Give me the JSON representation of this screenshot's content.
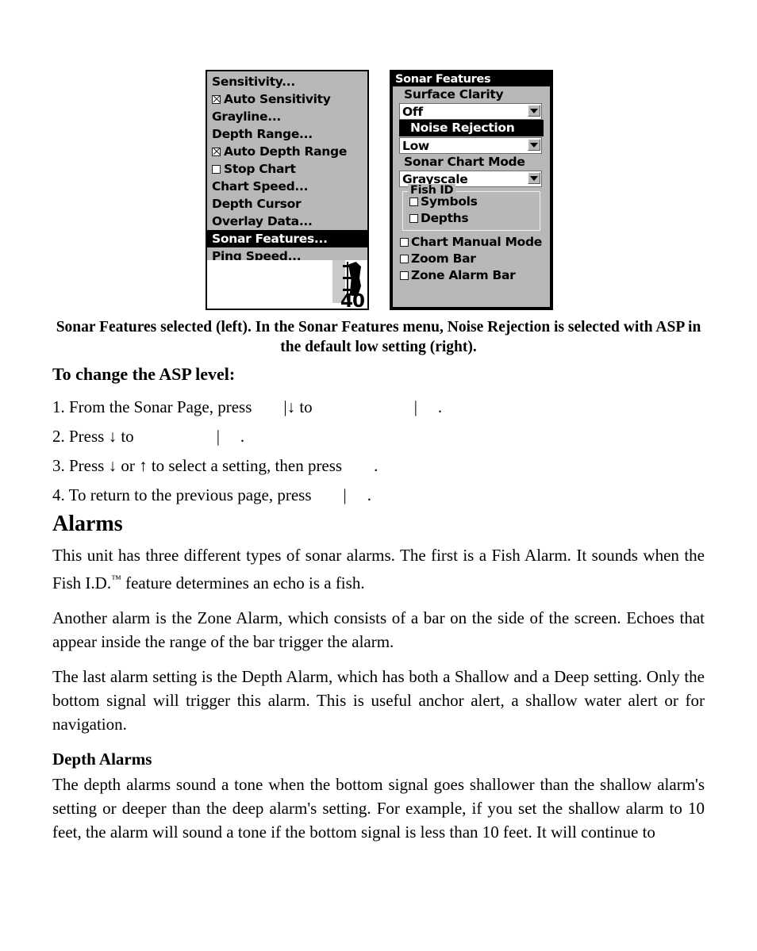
{
  "figure": {
    "left_panel": {
      "name": "sonar-main-menu",
      "items": [
        {
          "label": "Sensitivity...",
          "checkbox": "none",
          "selected": false
        },
        {
          "label": "Auto Sensitivity",
          "checkbox": "checked",
          "selected": false
        },
        {
          "label": "Grayline...",
          "checkbox": "none",
          "selected": false
        },
        {
          "label": "Depth Range...",
          "checkbox": "none",
          "selected": false
        },
        {
          "label": "Auto Depth Range",
          "checkbox": "checked",
          "selected": false
        },
        {
          "label": "Stop Chart",
          "checkbox": "empty",
          "selected": false
        },
        {
          "label": "Chart Speed...",
          "checkbox": "none",
          "selected": false
        },
        {
          "label": "Depth Cursor",
          "checkbox": "none",
          "selected": false
        },
        {
          "label": "Overlay Data...",
          "checkbox": "none",
          "selected": false
        },
        {
          "label": "Sonar Features...",
          "checkbox": "none",
          "selected": true
        },
        {
          "label": "Ping Speed...",
          "checkbox": "none",
          "selected": false
        }
      ],
      "sonar_chart": {
        "depth_label": "40"
      }
    },
    "right_panel": {
      "title": "Sonar Features",
      "surface_clarity": {
        "label": "Surface Clarity",
        "value": "Off",
        "highlighted": false
      },
      "noise_rejection": {
        "label": "Noise Rejection",
        "value": "Low",
        "highlighted": true
      },
      "sonar_chart_mode": {
        "label": "Sonar Chart Mode",
        "value": "Grayscale",
        "highlighted": false
      },
      "fish_id": {
        "legend": "Fish ID",
        "options": [
          {
            "label": "Symbols",
            "checked": false
          },
          {
            "label": "Depths",
            "checked": false
          }
        ]
      },
      "checkboxes": [
        {
          "label": "Chart Manual Mode",
          "checked": false
        },
        {
          "label": "Zoom Bar",
          "checked": false
        },
        {
          "label": "Zone Alarm Bar",
          "checked": false
        }
      ]
    }
  },
  "caption": "Sonar Features selected (left). In the Sonar Features menu, Noise Rejection is selected with ASP in the default low setting (right).",
  "howto_heading": "To change the ASP level:",
  "steps": [
    {
      "num": "1.",
      "a": "From the Sonar Page, press",
      "b": "|↓ to",
      "c": "|",
      "d": "."
    },
    {
      "num": "2.",
      "a": "Press ↓ to",
      "b": "|",
      "c": "."
    },
    {
      "num": "3.",
      "a": "Press ↓ or ↑ to select a setting, then press",
      "b": "."
    },
    {
      "num": "4.",
      "a": "To return to the previous page, press",
      "b": "|",
      "c": "."
    }
  ],
  "alarms_heading": "Alarms",
  "paragraphs": [
    "This unit has three different types of sonar alarms. The first is a Fish Alarm. It sounds when the Fish I.D.™ feature determines an echo is a fish.",
    "Another alarm is the Zone Alarm, which consists of a bar on the side of the screen. Echoes that appear inside the range of the bar trigger the alarm.",
    "The last alarm setting is the Depth Alarm, which has both a Shallow and a Deep setting. Only the bottom signal will trigger this alarm. This is useful anchor alert, a shallow water alert or for navigation."
  ],
  "depth_alarms_heading": "Depth Alarms",
  "depth_alarms_paragraph": "The depth alarms sound a tone when the bottom signal goes shallower than the shallow alarm's setting or deeper than the deep alarm's setting. For example, if you set the shallow alarm to 10 feet, the alarm will sound a tone if the bottom signal is less than 10 feet. It will continue to"
}
